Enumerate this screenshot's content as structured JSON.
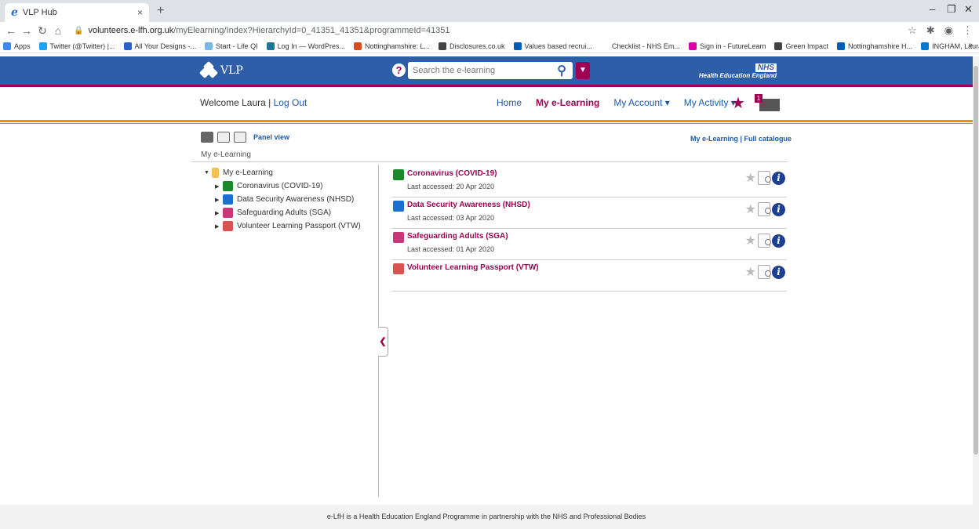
{
  "browser": {
    "tab_title": "VLP Hub",
    "tab_close": "×",
    "new_tab": "+",
    "url_host": "volunteers.e-lfh.org.uk",
    "url_path": "/myElearning/Index?HierarchyId=0_41351_41351&programmeId=41351",
    "bookmarks": [
      {
        "label": "Apps",
        "color": "#4285f4"
      },
      {
        "label": "Twitter (@Twitter) |...",
        "color": "#1da1f2"
      },
      {
        "label": "All Your Designs -...",
        "color": "#2563c9"
      },
      {
        "label": "Start - Life QI",
        "color": "#7ab8e8"
      },
      {
        "label": "Log In — WordPres...",
        "color": "#21759b"
      },
      {
        "label": "Nottinghamshire: L...",
        "color": "#d64e1e"
      },
      {
        "label": "Disclosures.co.uk",
        "color": "#444444"
      },
      {
        "label": "Values based recrui...",
        "color": "#005eb8"
      },
      {
        "label": "Checklist - NHS Em...",
        "color": "#ffffff"
      },
      {
        "label": "Sign in - FutureLearn",
        "color": "#de00a5"
      },
      {
        "label": "Green Impact",
        "color": "#444444"
      },
      {
        "label": "Nottinghamshire H...",
        "color": "#005eb8"
      },
      {
        "label": "INGHAM, Laura (N...",
        "color": "#0078d4"
      }
    ],
    "bookmarks_more": "»"
  },
  "header": {
    "logo_text": "VLP",
    "help_label": "?",
    "search_placeholder": "Search the e-learning",
    "nhs_label": "NHS",
    "hee_label": "Health Education England"
  },
  "subnav": {
    "welcome": "Welcome Laura",
    "separator": " | ",
    "logout": "Log Out",
    "items": [
      {
        "label": "Home"
      },
      {
        "label": "My e-Learning"
      },
      {
        "label": "My Account ▾"
      },
      {
        "label": "My Activity ▾"
      }
    ],
    "mail_count": "1"
  },
  "content": {
    "panel_view": "Panel view",
    "link_my_elearning": "My e-Learning",
    "link_sep": " | ",
    "link_full_catalogue": "Full catalogue",
    "breadcrumb": "My e-Learning",
    "tree": {
      "root": "My e-Learning",
      "children": [
        {
          "label": "Coronavirus (COVID-19)",
          "color": "#1a8a2a"
        },
        {
          "label": "Data Security Awareness (NHSD)",
          "color": "#1c6fd1"
        },
        {
          "label": "Safeguarding Adults (SGA)",
          "color": "#c9367a"
        },
        {
          "label": "Volunteer Learning Passport (VTW)",
          "color": "#d9534f"
        }
      ]
    },
    "courses": [
      {
        "name": "Coronavirus (COVID-19)",
        "accessed": "Last accessed: 20 Apr 2020",
        "color": "#1a8a2a"
      },
      {
        "name": "Data Security Awareness (NHSD)",
        "accessed": "Last accessed: 03 Apr 2020",
        "color": "#1c6fd1"
      },
      {
        "name": "Safeguarding Adults (SGA)",
        "accessed": "Last accessed: 01 Apr 2020",
        "color": "#c9367a"
      },
      {
        "name": "Volunteer Learning Passport (VTW)",
        "accessed": "",
        "color": "#d9534f"
      }
    ]
  },
  "footer": {
    "text": "e-LfH is a Health Education England Programme in partnership with the NHS and Professional Bodies"
  },
  "colors": {
    "header_blue": "#2f5ea9",
    "accent_magenta": "#a00054",
    "accent_orange": "#f29100",
    "link_blue": "#1c5aa9"
  }
}
